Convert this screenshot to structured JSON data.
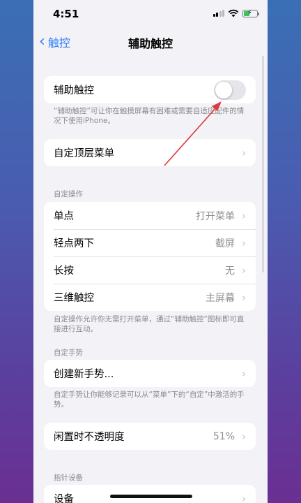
{
  "status_bar": {
    "time": "4:51"
  },
  "nav": {
    "back_label": "触控",
    "title": "辅助触控"
  },
  "main_toggle": {
    "label": "辅助触控",
    "enabled": false
  },
  "main_footnote": "“辅助触控”可让你在触摸屏幕有困难或需要自适应配件的情况下使用iPhone。",
  "top_menu": {
    "label": "自定顶层菜单"
  },
  "custom_actions": {
    "header": "自定操作",
    "rows": [
      {
        "label": "单点",
        "value": "打开菜单"
      },
      {
        "label": "轻点两下",
        "value": "截屏"
      },
      {
        "label": "长按",
        "value": "无"
      },
      {
        "label": "三维触控",
        "value": "主屏幕"
      }
    ],
    "footnote": "自定操作允许你无需打开菜单，通过“辅助触控”图标即可直接进行互动。"
  },
  "custom_gestures": {
    "header": "自定手势",
    "row_label": "创建新手势...",
    "footnote": "自定手势让你能够记录可以从“菜单”下的“自定”中激活的手势。"
  },
  "idle_opacity": {
    "label": "闲置时不透明度",
    "value": "51%"
  },
  "pointer_devices": {
    "header": "指针设备",
    "row_label": "设备"
  },
  "colors": {
    "accent": "#2f7cf6",
    "annotation_arrow": "#e0393e"
  }
}
